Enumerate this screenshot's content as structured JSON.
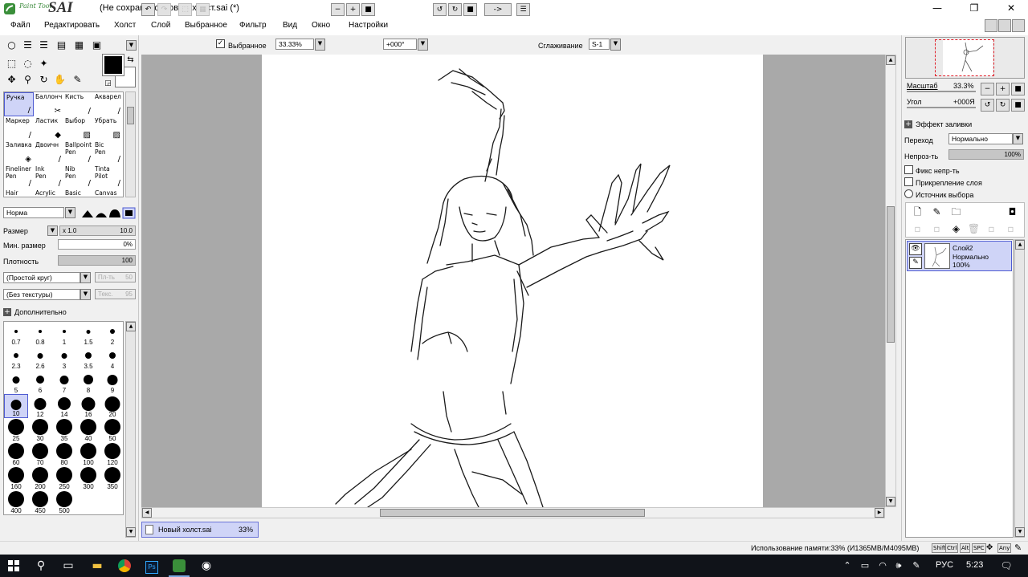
{
  "window": {
    "title": "(Не сохранено)Новый холст.sai (*)",
    "logo_small": "Paint Tool",
    "logo_big": "SAI",
    "minimize": "—",
    "restore": "❐",
    "close": "✕"
  },
  "menu": [
    "Файл",
    "Редактировать",
    "Холст",
    "Слой",
    "Выбранное",
    "Фильтр",
    "Вид",
    "Окно",
    "Настройки"
  ],
  "toolbar": {
    "selection_label": "Выбранное",
    "zoom": "33.33%",
    "angle": "+000°",
    "flip_label": "->",
    "smoothing_label": "Сглаживание",
    "smoothing_value": "S-1"
  },
  "tools": [
    {
      "name": "Ручка",
      "sub": ""
    },
    {
      "name": "Баллонч",
      "sub": ""
    },
    {
      "name": "Кисть",
      "sub": ""
    },
    {
      "name": "Акварел",
      "sub": ""
    },
    {
      "name": "Маркер",
      "sub": ""
    },
    {
      "name": "Ластик",
      "sub": ""
    },
    {
      "name": "Выбор",
      "sub": ""
    },
    {
      "name": "Убрать",
      "sub": ""
    },
    {
      "name": "Заливка",
      "sub": ""
    },
    {
      "name": "Двоичн",
      "sub": ""
    },
    {
      "name": "Ballpoint",
      "sub": "Pen"
    },
    {
      "name": "Bic",
      "sub": "Pen"
    },
    {
      "name": "Fineliner",
      "sub": "Pen"
    },
    {
      "name": "Ink",
      "sub": "Pen"
    },
    {
      "name": "Nib",
      "sub": "Pen"
    },
    {
      "name": "Tinta",
      "sub": "Pilot"
    },
    {
      "name": "Hair",
      "sub": ""
    },
    {
      "name": "Acrylic",
      "sub": ""
    },
    {
      "name": "Basic",
      "sub": ""
    },
    {
      "name": "Canvas",
      "sub": ""
    }
  ],
  "brush": {
    "mode": "Норма",
    "size_label": "Размер",
    "size_multiplier": "x 1.0",
    "size_value": "10.0",
    "min_size_label": "Мин. размер",
    "min_size_value": "0%",
    "density_label": "Плотность",
    "density_value": "100",
    "shape": "(Простой круг)",
    "shape_strength_label": "Пл-ть",
    "shape_strength": "50",
    "texture": "(Без текстуры)",
    "texture_strength_label": "Текс.",
    "texture_strength": "95",
    "advanced_label": "Дополнительно"
  },
  "brush_sizes": [
    "0.7",
    "0.8",
    "1",
    "1.5",
    "2",
    "2.3",
    "2.6",
    "3",
    "3.5",
    "4",
    "5",
    "6",
    "7",
    "8",
    "9",
    "10",
    "12",
    "14",
    "16",
    "20",
    "25",
    "30",
    "35",
    "40",
    "50",
    "60",
    "70",
    "80",
    "100",
    "120",
    "160",
    "200",
    "250",
    "300",
    "350",
    "400",
    "450",
    "500"
  ],
  "selected_size": "10",
  "navigator": {
    "scale_label": "Масштаб",
    "scale_value": "33.3%",
    "angle_label": "Угол",
    "angle_value": "+000Я"
  },
  "layer_props": {
    "fill_effect_label": "Эффект заливки",
    "blend_label": "Переход",
    "blend_value": "Нормально",
    "opacity_label": "Непроз-ть",
    "opacity_value": "100%",
    "opacity_fraction": 1.0,
    "preserve_opacity": "Фикс непр-ть",
    "clipping": "Прикрепление слоя",
    "selection_source": "Источник выбора"
  },
  "layer": {
    "name": "Слой2",
    "mode": "Нормально",
    "opacity": "100%"
  },
  "document_tab": {
    "name": "Новый холст.sai",
    "zoom": "33%"
  },
  "status": {
    "memory": "Использование памяти:33% (И1365MB/M4095MB)",
    "keys": [
      "Shift",
      "Ctrl",
      "Alt",
      "SPC",
      "Any"
    ]
  },
  "taskbar": {
    "language": "РУС",
    "time": "5:23"
  },
  "colors": {
    "primary": "#000000",
    "secondary": "#ffffff",
    "selection": "#cfd4f7",
    "selection_border": "#4e5bd2",
    "canvas_bg": "#a9a9a9",
    "taskbar": "#101319"
  }
}
